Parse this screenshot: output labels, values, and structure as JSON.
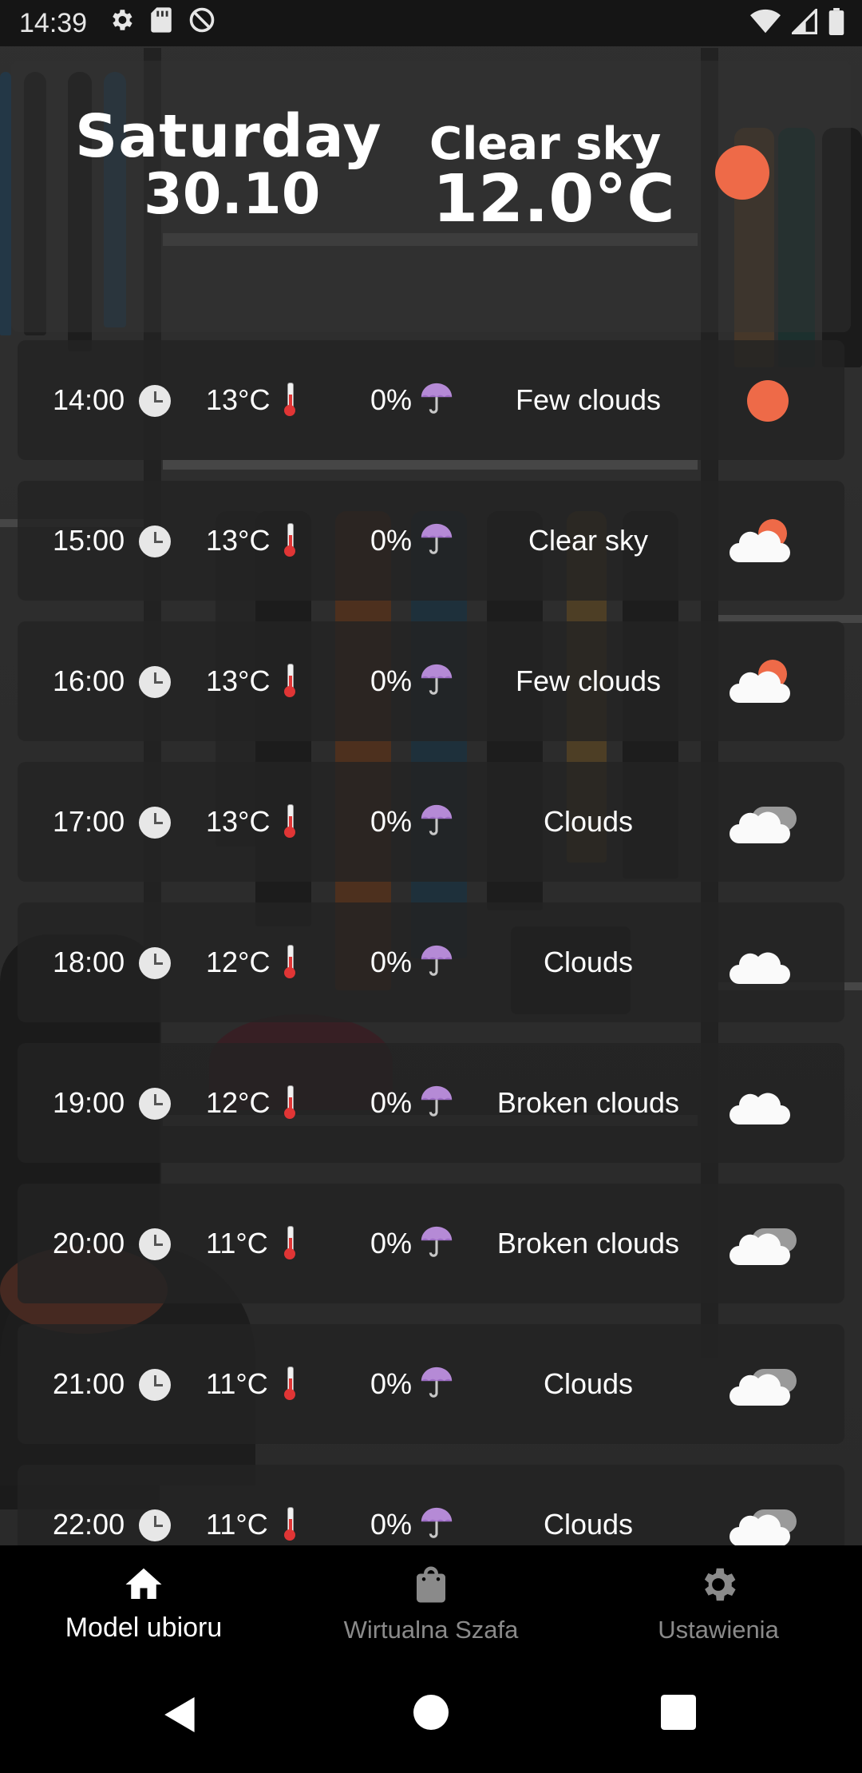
{
  "status_bar": {
    "time": "14:39",
    "left_icons": [
      "gear-icon",
      "sd-card-icon",
      "sync-off-icon"
    ],
    "right_icons": [
      "wifi-icon",
      "cell-signal-icon",
      "battery-icon"
    ]
  },
  "header": {
    "day": "Saturday",
    "date": "30.10",
    "description": "Clear sky",
    "temperature": "12.0°C",
    "icon": "sun-icon"
  },
  "hourly": [
    {
      "hour": "14:00",
      "temp": "13°C",
      "rain": "0%",
      "condition": "Few clouds",
      "icon": "sun"
    },
    {
      "hour": "15:00",
      "temp": "13°C",
      "rain": "0%",
      "condition": "Clear sky",
      "icon": "few-clouds"
    },
    {
      "hour": "16:00",
      "temp": "13°C",
      "rain": "0%",
      "condition": "Few clouds",
      "icon": "few-clouds"
    },
    {
      "hour": "17:00",
      "temp": "13°C",
      "rain": "0%",
      "condition": "Clouds",
      "icon": "clouds"
    },
    {
      "hour": "18:00",
      "temp": "12°C",
      "rain": "0%",
      "condition": "Clouds",
      "icon": "cloud"
    },
    {
      "hour": "19:00",
      "temp": "12°C",
      "rain": "0%",
      "condition": "Broken clouds",
      "icon": "cloud"
    },
    {
      "hour": "20:00",
      "temp": "11°C",
      "rain": "0%",
      "condition": "Broken clouds",
      "icon": "clouds"
    },
    {
      "hour": "21:00",
      "temp": "11°C",
      "rain": "0%",
      "condition": "Clouds",
      "icon": "clouds"
    },
    {
      "hour": "22:00",
      "temp": "11°C",
      "rain": "0%",
      "condition": "Clouds",
      "icon": "clouds"
    }
  ],
  "bottom_nav": {
    "tabs": [
      {
        "label": "Model ubioru",
        "icon": "home-icon",
        "active": true
      },
      {
        "label": "Wirtualna Szafa",
        "icon": "shopping-bag-icon",
        "active": false
      },
      {
        "label": "Ustawienia",
        "icon": "gear-icon",
        "active": false
      }
    ]
  },
  "system_nav": [
    "back-icon",
    "home-circle-icon",
    "recents-square-icon"
  ],
  "colors": {
    "accent_sun": "#ee6a48",
    "nav_active": "#ffffff",
    "nav_inactive": "#8a8a8a"
  }
}
